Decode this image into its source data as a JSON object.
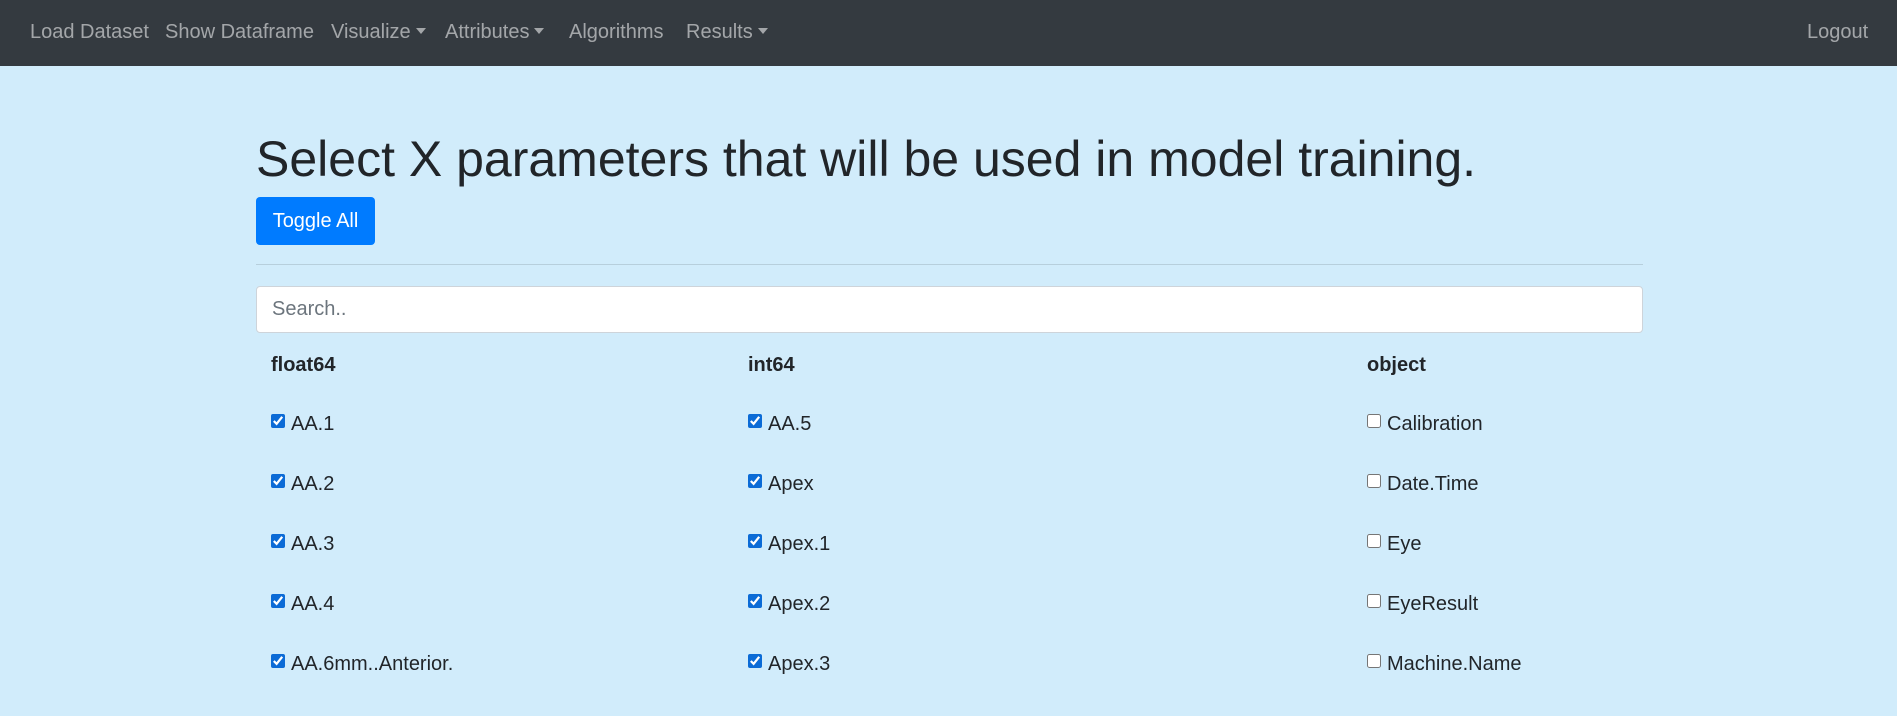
{
  "navbar": {
    "items": [
      {
        "label": "Load Dataset",
        "dropdown": false
      },
      {
        "label": "Show Dataframe",
        "dropdown": false
      },
      {
        "label": "Visualize",
        "dropdown": true
      },
      {
        "label": "Attributes",
        "dropdown": true
      },
      {
        "label": "Algorithms",
        "dropdown": false
      },
      {
        "label": "Results",
        "dropdown": true
      }
    ],
    "logout": "Logout"
  },
  "page": {
    "title": "Select X parameters that will be used in model training.",
    "toggle_label": "Toggle All",
    "search_placeholder": "Search.."
  },
  "columns": [
    {
      "header": "float64",
      "items": [
        {
          "label": "AA.1",
          "checked": true
        },
        {
          "label": "AA.2",
          "checked": true
        },
        {
          "label": "AA.3",
          "checked": true
        },
        {
          "label": "AA.4",
          "checked": true
        },
        {
          "label": "AA.6mm..Anterior.",
          "checked": true
        }
      ]
    },
    {
      "header": "int64",
      "items": [
        {
          "label": "AA.5",
          "checked": true
        },
        {
          "label": "Apex",
          "checked": true
        },
        {
          "label": "Apex.1",
          "checked": true
        },
        {
          "label": "Apex.2",
          "checked": true
        },
        {
          "label": "Apex.3",
          "checked": true
        }
      ]
    },
    {
      "header": "object",
      "items": [
        {
          "label": "Calibration",
          "checked": false
        },
        {
          "label": "Date.Time",
          "checked": false
        },
        {
          "label": "Eye",
          "checked": false
        },
        {
          "label": "EyeResult",
          "checked": false
        },
        {
          "label": "Machine.Name",
          "checked": false
        }
      ]
    }
  ],
  "colors": {
    "navbar_bg": "#343a40",
    "page_bg": "#d1ecfb",
    "primary": "#007bff"
  }
}
